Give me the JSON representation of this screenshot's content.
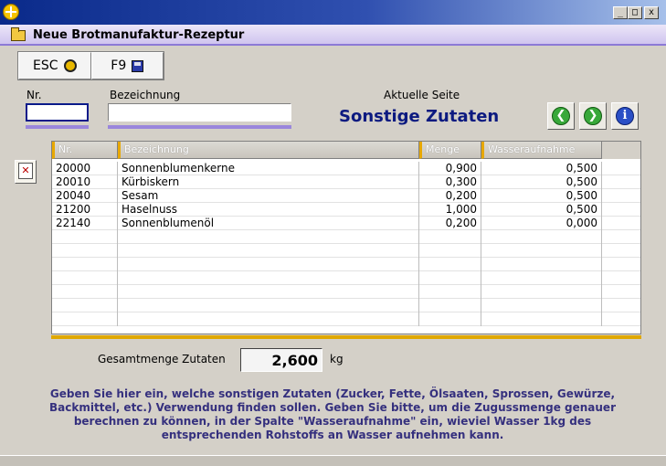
{
  "window": {
    "title": "",
    "controls": {
      "minimize": "_",
      "maximize": "□",
      "close": "x"
    }
  },
  "form": {
    "title": "Neue Brotmanufaktur-Rezeptur"
  },
  "toolbar": {
    "esc_label": "ESC",
    "f9_label": "F9"
  },
  "fields": {
    "nr_label": "Nr.",
    "nr_value": "",
    "bezeichnung_label": "Bezeichnung",
    "bezeichnung_value": ""
  },
  "page": {
    "current_label": "Aktuelle Seite",
    "current_title": "Sonstige Zutaten"
  },
  "icons": {
    "back": "arrow-left-icon",
    "forward": "arrow-right-icon",
    "info": "info-icon",
    "delete_row": "delete-row-icon"
  },
  "table": {
    "columns": [
      "Nr.",
      "Bezeichnung",
      "Menge",
      "Wasseraufnahme"
    ],
    "rows": [
      {
        "nr": "20000",
        "bezeichnung": "Sonnenblumenkerne",
        "menge": "0,900",
        "wasser": "0,500"
      },
      {
        "nr": "20010",
        "bezeichnung": "Kürbiskern",
        "menge": "0,300",
        "wasser": "0,500"
      },
      {
        "nr": "20040",
        "bezeichnung": "Sesam",
        "menge": "0,200",
        "wasser": "0,500"
      },
      {
        "nr": "21200",
        "bezeichnung": "Haselnuss",
        "menge": "1,000",
        "wasser": "0,500"
      },
      {
        "nr": "22140",
        "bezeichnung": "Sonnenblumenöl",
        "menge": "0,200",
        "wasser": "0,000"
      }
    ]
  },
  "total": {
    "label": "Gesamtmenge Zutaten",
    "value": "2,600",
    "unit": "kg"
  },
  "info_text": [
    "Geben Sie hier ein, welche sonstigen Zutaten (Zucker, Fette, Ölsaaten, Sprossen, Gewürze,",
    "Backmittel, etc.) Verwendung finden sollen. Geben Sie bitte, um die Zugussmenge genauer",
    "berechnen zu können, in der Spalte \"Wasseraufnahme\" ein, wieviel Wasser 1kg des",
    "entsprechenden Rohstoffs an Wasser aufnehmen kann."
  ],
  "colors": {
    "title_text": "#0c1a80",
    "accent_gold": "#e0a800",
    "accent_lavender": "#9a86dc",
    "info_text": "#35307e"
  }
}
